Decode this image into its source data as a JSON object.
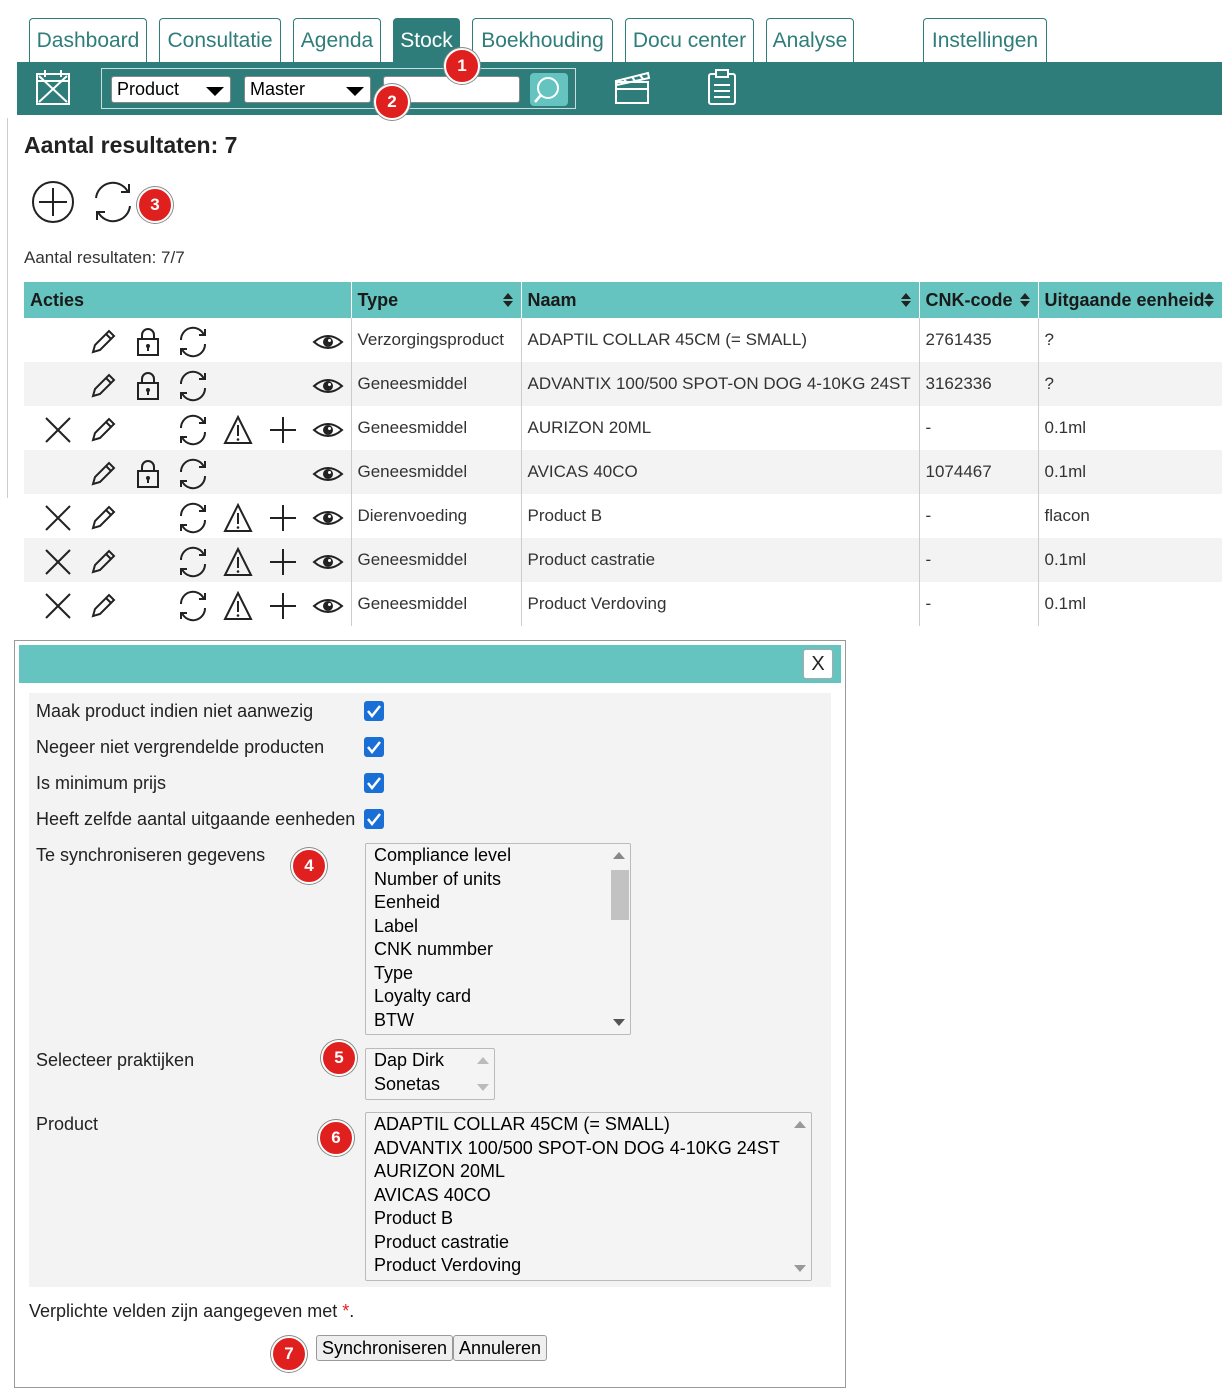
{
  "tabs": [
    {
      "label": "Dashboard",
      "active": false
    },
    {
      "label": "Consultatie",
      "active": false
    },
    {
      "label": "Agenda",
      "active": false
    },
    {
      "label": "Stock",
      "active": true
    },
    {
      "label": "Boekhouding",
      "active": false
    },
    {
      "label": "Docu center",
      "active": false
    },
    {
      "label": "Analyse",
      "active": false
    },
    {
      "label": "Instellingen",
      "active": false
    }
  ],
  "toolbar": {
    "filter_type": "Product",
    "filter_source": "Master",
    "search_value": "",
    "icons": [
      "calendar-x-icon",
      "search-icon",
      "clapperboard-icon",
      "clipboard-list-icon"
    ]
  },
  "badges": [
    "1",
    "2",
    "3",
    "4",
    "5",
    "6",
    "7"
  ],
  "results": {
    "heading": "Aantal resultaten: 7",
    "count_line": "Aantal resultaten: 7/7"
  },
  "table": {
    "headers": [
      "Acties",
      "Type",
      "Naam",
      "CNK-code",
      "Uitgaande eenheid"
    ],
    "rows": [
      {
        "actions": [
          "edit",
          "lock",
          "sync",
          "view"
        ],
        "type": "Verzorgingsproduct",
        "name": "ADAPTIL COLLAR 45CM (= SMALL)",
        "cnk": "2761435",
        "unit": "?"
      },
      {
        "actions": [
          "edit",
          "lock",
          "sync",
          "view"
        ],
        "type": "Geneesmiddel",
        "name": "ADVANTIX 100/500 SPOT-ON DOG 4-10KG 24ST",
        "cnk": "3162336",
        "unit": "?"
      },
      {
        "actions": [
          "delete",
          "edit",
          "sync",
          "warning",
          "add",
          "view"
        ],
        "type": "Geneesmiddel",
        "name": "AURIZON 20ML",
        "cnk": "-",
        "unit": "0.1ml"
      },
      {
        "actions": [
          "edit",
          "lock",
          "sync",
          "view"
        ],
        "type": "Geneesmiddel",
        "name": "AVICAS 40CO",
        "cnk": "1074467",
        "unit": "0.1ml"
      },
      {
        "actions": [
          "delete",
          "edit",
          "sync",
          "warning",
          "add",
          "view"
        ],
        "type": "Dierenvoeding",
        "name": "Product B",
        "cnk": "-",
        "unit": "flacon"
      },
      {
        "actions": [
          "delete",
          "edit",
          "sync",
          "warning",
          "add",
          "view"
        ],
        "type": "Geneesmiddel",
        "name": "Product castratie",
        "cnk": "-",
        "unit": "0.1ml"
      },
      {
        "actions": [
          "delete",
          "edit",
          "sync",
          "warning",
          "add",
          "view"
        ],
        "type": "Geneesmiddel",
        "name": "Product Verdoving",
        "cnk": "-",
        "unit": "0.1ml"
      }
    ]
  },
  "dialog": {
    "close_label": "X",
    "checkboxes": [
      {
        "label": "Maak product indien niet aanwezig",
        "checked": true
      },
      {
        "label": "Negeer niet vergrendelde producten",
        "checked": true
      },
      {
        "label": "Is minimum prijs",
        "checked": true
      },
      {
        "label": "Heeft zelfde aantal uitgaande eenheden",
        "checked": true
      }
    ],
    "sync_label": "Te synchroniseren gegevens",
    "sync_options": [
      "Compliance level",
      "Number of units",
      "Eenheid",
      "Label",
      "CNK nummber",
      "Type",
      "Loyalty card",
      "BTW"
    ],
    "practice_label": "Selecteer praktijken",
    "practice_options": [
      "Dap Dirk",
      "Sonetas"
    ],
    "product_label": "Product",
    "product_options": [
      "ADAPTIL COLLAR 45CM (= SMALL)",
      "ADVANTIX 100/500 SPOT-ON DOG 4-10KG 24ST",
      "AURIZON 20ML",
      "AVICAS 40CO",
      "Product B",
      "Product castratie",
      "Product Verdoving"
    ],
    "note_text": "Verplichte velden zijn aangegeven met ",
    "note_star": "*",
    "note_end": ".",
    "submit_label": "Synchroniseren",
    "cancel_label": "Annuleren"
  },
  "colors": {
    "toolbar": "#2e7d7a",
    "header": "#65c4bf",
    "badge": "#e01f1f",
    "checkbox": "#1a6fd6"
  }
}
